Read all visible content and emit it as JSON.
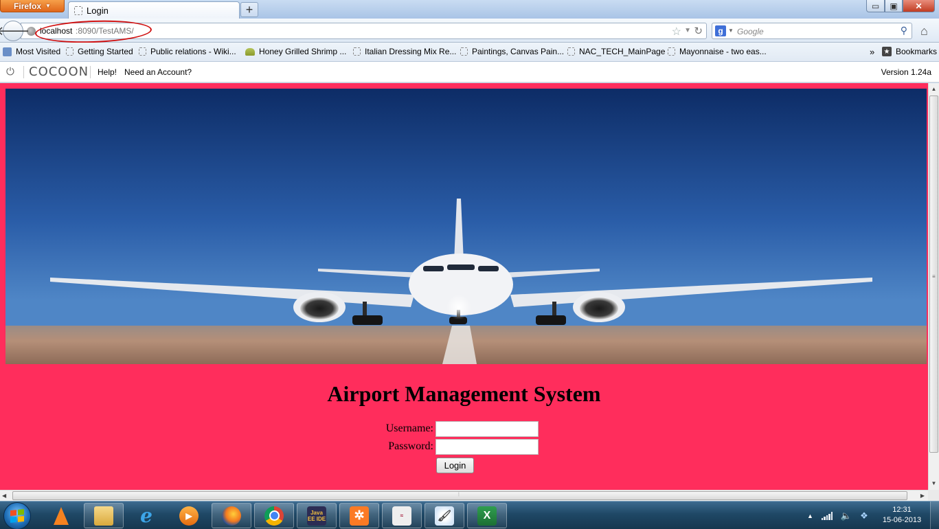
{
  "browser": {
    "app_button": "Firefox",
    "tab_title": "Login",
    "new_tab_glyph": "+",
    "url_host": "localhost",
    "url_rest": ":8090/TestAMS/",
    "search_engine_letter": "g",
    "search_placeholder": "Google",
    "window_controls": {
      "minimize": "▭",
      "maximize": "▣",
      "close": "✕"
    }
  },
  "bookmarks": {
    "items": [
      {
        "label": "Most Visited",
        "icon": "most-visited-icon"
      },
      {
        "label": "Getting Started",
        "icon": "page-icon"
      },
      {
        "label": "Public relations - Wiki...",
        "icon": "page-icon"
      },
      {
        "label": "Honey Grilled Shrimp ...",
        "icon": "leaf-icon"
      },
      {
        "label": "Italian Dressing Mix Re...",
        "icon": "page-icon"
      },
      {
        "label": "Paintings, Canvas Pain...",
        "icon": "page-icon"
      },
      {
        "label": "NAC_TECH_MainPage",
        "icon": "page-icon"
      },
      {
        "label": "Mayonnaise - two eas...",
        "icon": "page-icon"
      }
    ],
    "overflow": "»",
    "bookmarks_menu": "Bookmarks"
  },
  "cocoon": {
    "logo": "COCOON",
    "help": "Help!",
    "account": "Need an Account?",
    "version": "Version 1.24a"
  },
  "page": {
    "title": "Airport Management System",
    "username_label": "Username:",
    "password_label": "Password:",
    "username_value": "",
    "password_value": "",
    "login_button": "Login",
    "background_color": "#ff2d5c"
  },
  "taskbar": {
    "pinned": [
      "vlc-icon",
      "explorer-icon",
      "ie-icon",
      "media-player-icon",
      "firefox-icon",
      "chrome-icon",
      "javaee-ide-icon",
      "xampp-icon",
      "app-icon",
      "paint-icon",
      "excel-icon"
    ],
    "javaee_label": "Java EE IDE",
    "excel_label": "X",
    "clock_time": "12:31",
    "clock_date": "15-06-2013"
  }
}
